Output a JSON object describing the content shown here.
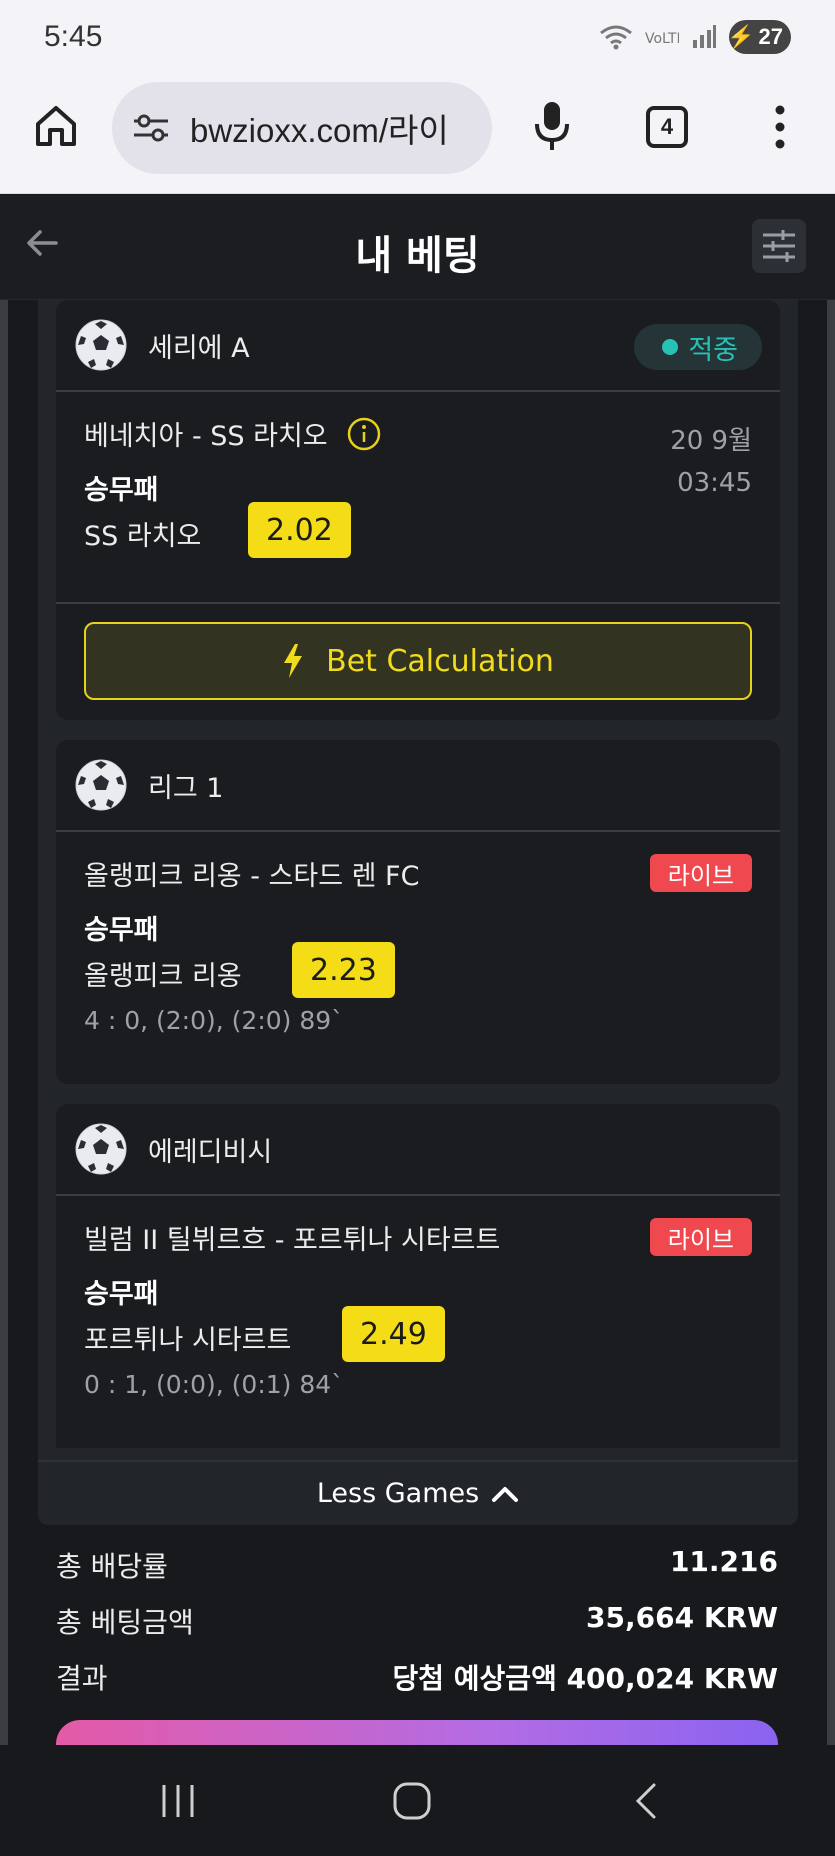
{
  "status_bar": {
    "time": "5:45",
    "battery": "27"
  },
  "browser": {
    "url": "bwzioxx.com/라이",
    "tab_count": "4"
  },
  "header": {
    "title": "내 베팅"
  },
  "bets": [
    {
      "league": "세리에 A",
      "status": "적중",
      "match": "베네치아 - SS 라치오",
      "date": "20 9월",
      "time": "03:45",
      "market": "승무패",
      "selection": "SS 라치오",
      "odds": "2.02",
      "calc_label": "Bet Calculation"
    },
    {
      "league": "리그 1",
      "badge": "라이브",
      "match": "올랭피크 리옹 - 스타드 렌 FC",
      "market": "승무패",
      "selection": "올랭피크 리옹",
      "odds": "2.23",
      "score": "4 : 0, (2:0), (2:0) 89`"
    },
    {
      "league": "에레디비시",
      "badge": "라이브",
      "match": "빌럼 II 틸뷔르흐 - 포르튀나 시타르트",
      "market": "승무패",
      "selection": "포르튀나 시타르트",
      "odds": "2.49",
      "score": "0 : 1, (0:0), (0:1) 84`"
    }
  ],
  "less_games_label": "Less Games",
  "summary": {
    "total_odds_label": "총 배당률",
    "total_odds": "11.216",
    "total_stake_label": "총 베팅금액",
    "total_stake": "35,664 KRW",
    "result_label": "결과",
    "result_value": "당첨 예상금액 400,024 KRW"
  },
  "colors": {
    "accent_yellow": "#f4dc17",
    "live_red": "#f0484f",
    "win_teal": "#27c2b6",
    "background": "#17191d"
  },
  "icons": [
    "home-icon",
    "tune-icon",
    "mic-icon",
    "more-icon",
    "back-arrow-icon",
    "filter-icon",
    "soccer-ball-icon",
    "info-icon",
    "lightning-icon",
    "chevron-up-icon"
  ]
}
